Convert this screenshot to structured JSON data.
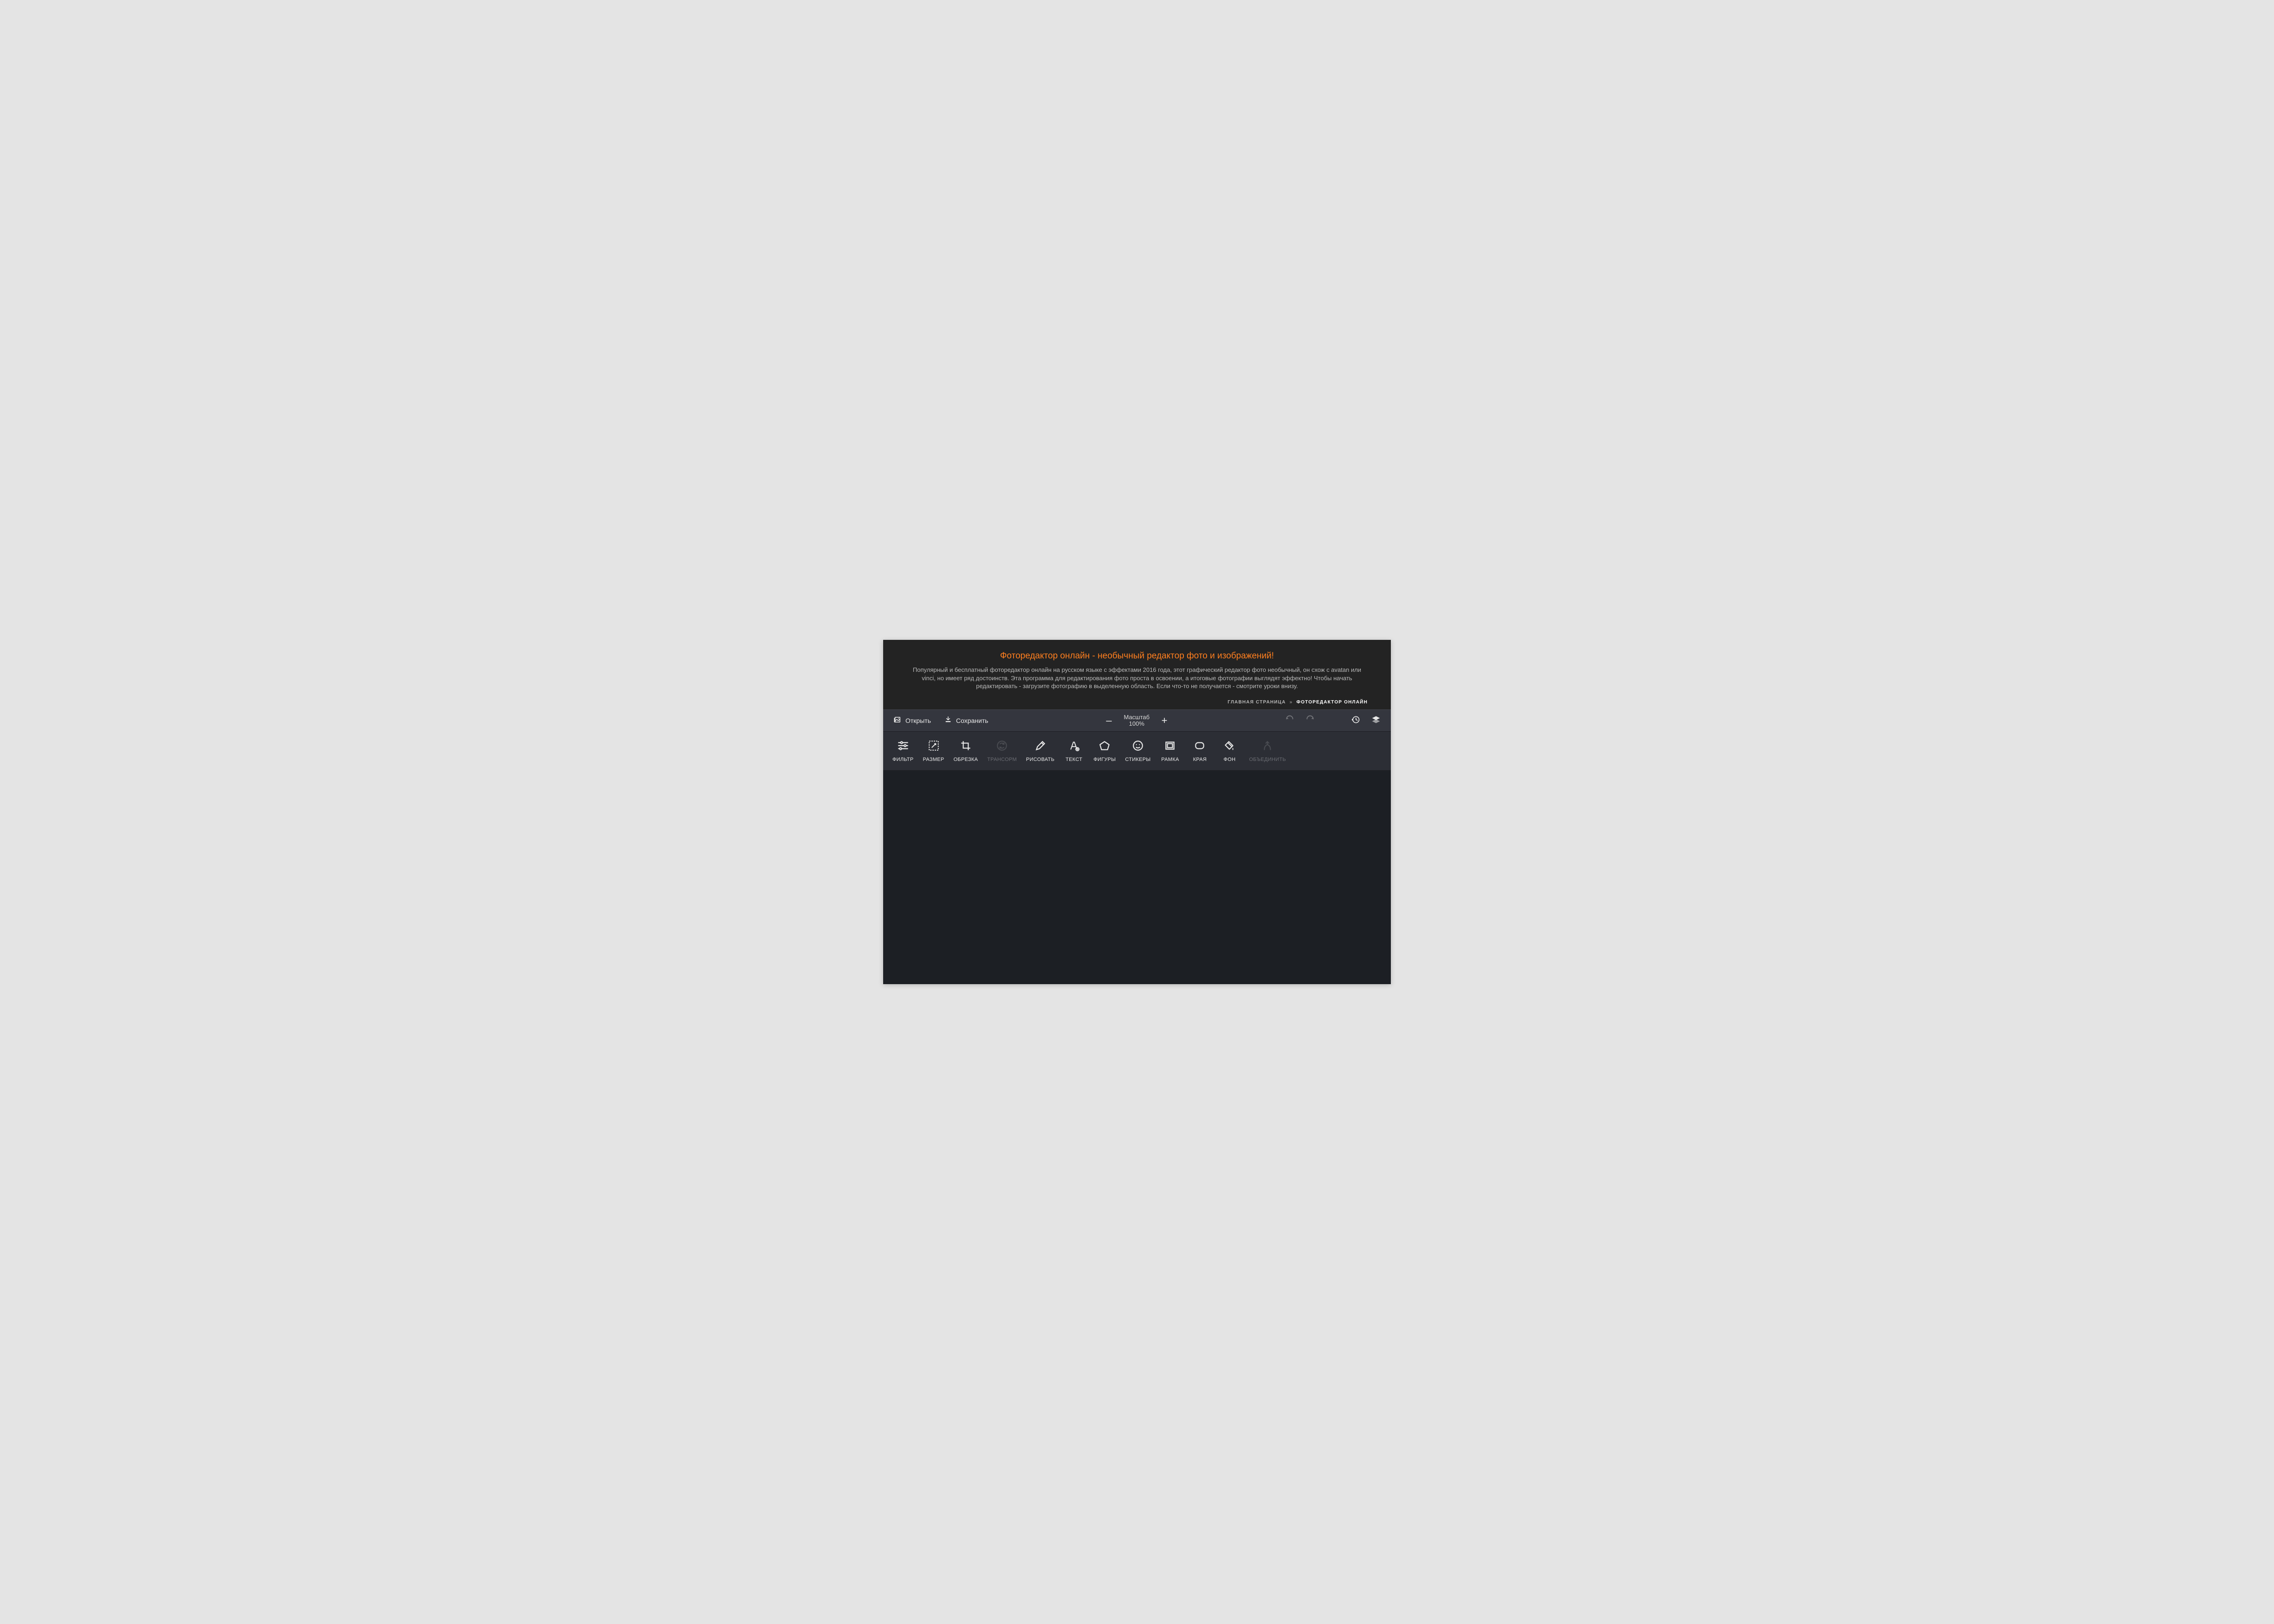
{
  "intro": {
    "title": "Фоторедактор онлайн - необычный редактор фото и изображений!",
    "description": "Популярный и бесплатный фоторедактор онлайн на русском языке с эффектами 2016 года, этот графический редактор фото необычный, он схож с avatan или vinci, но имеет ряд достоинств. Эта программа для редактирования фото проста в освоении, а итоговые фотографии выглядят эффектно! Чтобы начать редактировать - загрузите фотографию в выделенную область. Если что-то не получается - смотрите уроки внизу."
  },
  "breadcrumb": {
    "home": "ГЛАВНАЯ СТРАНИЦА",
    "separator": "»",
    "current": "ФОТОРЕДАКТОР ОНЛАЙН"
  },
  "topbar": {
    "open": "Открыть",
    "save": "Сохранить",
    "zoom_label": "Масштаб",
    "zoom_value": "100%",
    "minus": "–",
    "plus": "+"
  },
  "tools": [
    {
      "id": "filter",
      "label": "ФИЛЬТР",
      "disabled": false
    },
    {
      "id": "resize",
      "label": "РАЗМЕР",
      "disabled": false
    },
    {
      "id": "crop",
      "label": "ОБРЕЗКА",
      "disabled": false
    },
    {
      "id": "transform",
      "label": "ТРАНСОРМ",
      "disabled": true
    },
    {
      "id": "draw",
      "label": "РИСОВАТЬ",
      "disabled": false
    },
    {
      "id": "text",
      "label": "ТЕКСТ",
      "disabled": false
    },
    {
      "id": "shapes",
      "label": "ФИГУРЫ",
      "disabled": false
    },
    {
      "id": "stickers",
      "label": "СТИКЕРЫ",
      "disabled": false
    },
    {
      "id": "frame",
      "label": "РАМКА",
      "disabled": false
    },
    {
      "id": "corners",
      "label": "КРАЯ",
      "disabled": false
    },
    {
      "id": "background",
      "label": "ФОН",
      "disabled": false
    },
    {
      "id": "merge",
      "label": "ОБЪЕДИНИТЬ",
      "disabled": true
    }
  ]
}
